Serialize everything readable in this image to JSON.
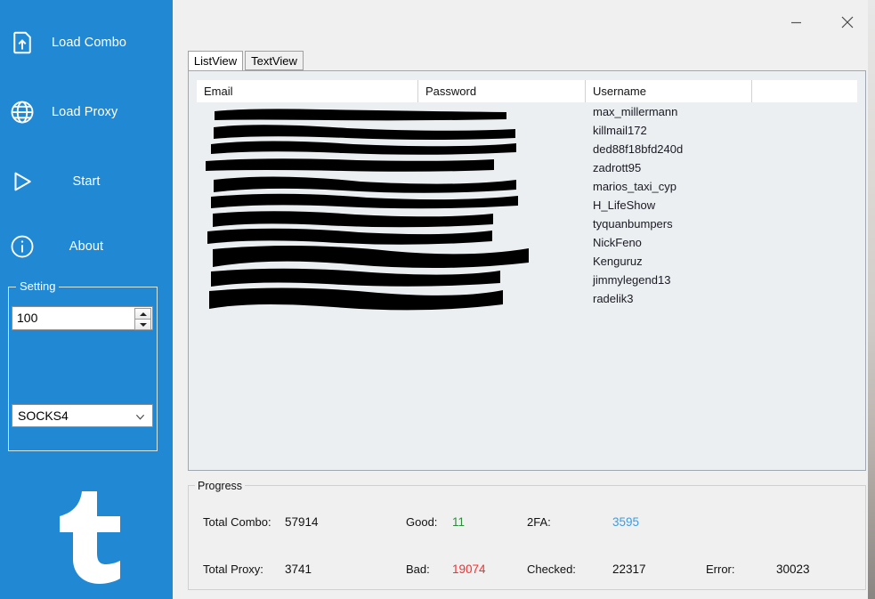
{
  "window": {
    "minimize_label": "–",
    "close_label": "×",
    "accent_color": "#2189d4"
  },
  "sidebar": {
    "items": [
      {
        "label": "Load Combo",
        "icon": "file-upload-icon",
        "centered": false
      },
      {
        "label": "Load Proxy",
        "icon": "globe-icon",
        "centered": false
      },
      {
        "label": "Start",
        "icon": "play-icon",
        "centered": true
      },
      {
        "label": "About",
        "icon": "info-icon",
        "centered": true
      }
    ],
    "setting": {
      "legend": "Setting",
      "threads_value": "100",
      "proxy_type_value": "SOCKS4",
      "proxy_type_options": [
        "SOCKS4"
      ]
    },
    "logo_name": "tumblr-logo"
  },
  "tabs": [
    {
      "id": "listview",
      "label": "ListView",
      "selected": true
    },
    {
      "id": "textview",
      "label": "TextView",
      "selected": false
    }
  ],
  "listview": {
    "columns": [
      "Email",
      "Password",
      "Username",
      ""
    ],
    "rows": [
      {
        "email": "",
        "password": "",
        "username": "max_millermann"
      },
      {
        "email": "",
        "password": "",
        "username": "killmail172"
      },
      {
        "email": "",
        "password": "",
        "username": "ded88f18bfd240d"
      },
      {
        "email": "",
        "password": "",
        "username": "zadrott95"
      },
      {
        "email": "",
        "password": "",
        "username": "marios_taxi_cyp"
      },
      {
        "email": "",
        "password": "",
        "username": "H_LifeShow"
      },
      {
        "email": "",
        "password": "",
        "username": "tyquanbumpers"
      },
      {
        "email": "",
        "password": "",
        "username": "NickFeno"
      },
      {
        "email": "",
        "password": "",
        "username": "Kenguruz"
      },
      {
        "email": "",
        "password": "",
        "username": "jimmylegend13"
      },
      {
        "email": "",
        "password": "",
        "username": "radelik3"
      }
    ]
  },
  "progress": {
    "legend": "Progress",
    "total_combo_label": "Total Combo:",
    "total_combo_value": "57914",
    "good_label": "Good:",
    "good_value": "11",
    "good_color": "#2e8b3d",
    "twofa_label": "2FA:",
    "twofa_value": "3595",
    "twofa_color": "#3d9de0",
    "total_proxy_label": "Total Proxy:",
    "total_proxy_value": "3741",
    "bad_label": "Bad:",
    "bad_value": "19074",
    "bad_color": "#ff2a2a",
    "checked_label": "Checked:",
    "checked_value": "22317",
    "error_label": "Error:",
    "error_value": "30023"
  }
}
